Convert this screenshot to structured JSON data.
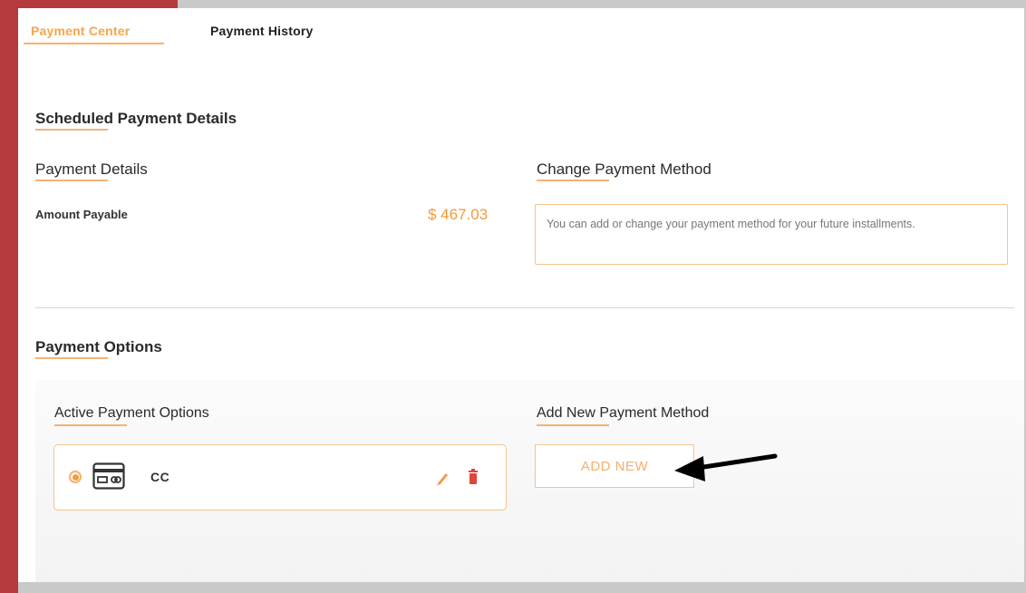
{
  "tabs": [
    {
      "label": "Payment Center",
      "active": true
    },
    {
      "label": "Payment History",
      "active": false
    }
  ],
  "scheduled": {
    "title": "Scheduled Payment Details"
  },
  "payment_details": {
    "title": "Payment Details",
    "amount_label": "Amount Payable",
    "amount_value": "$ 467.03"
  },
  "change_method": {
    "title": "Change Payment Method",
    "info_text": "You can add or change your payment method for your future installments."
  },
  "payment_options": {
    "title": "Payment Options",
    "active_title": "Active Payment Options",
    "active_items": [
      {
        "label": "CC",
        "selected": true,
        "icon": "credit-card-icon"
      }
    ],
    "add_title": "Add New Payment Method",
    "add_button": "ADD NEW"
  },
  "colors": {
    "accent": "#f39a3e",
    "frame_red": "#b53a3d",
    "delete_red": "#e0443c"
  }
}
